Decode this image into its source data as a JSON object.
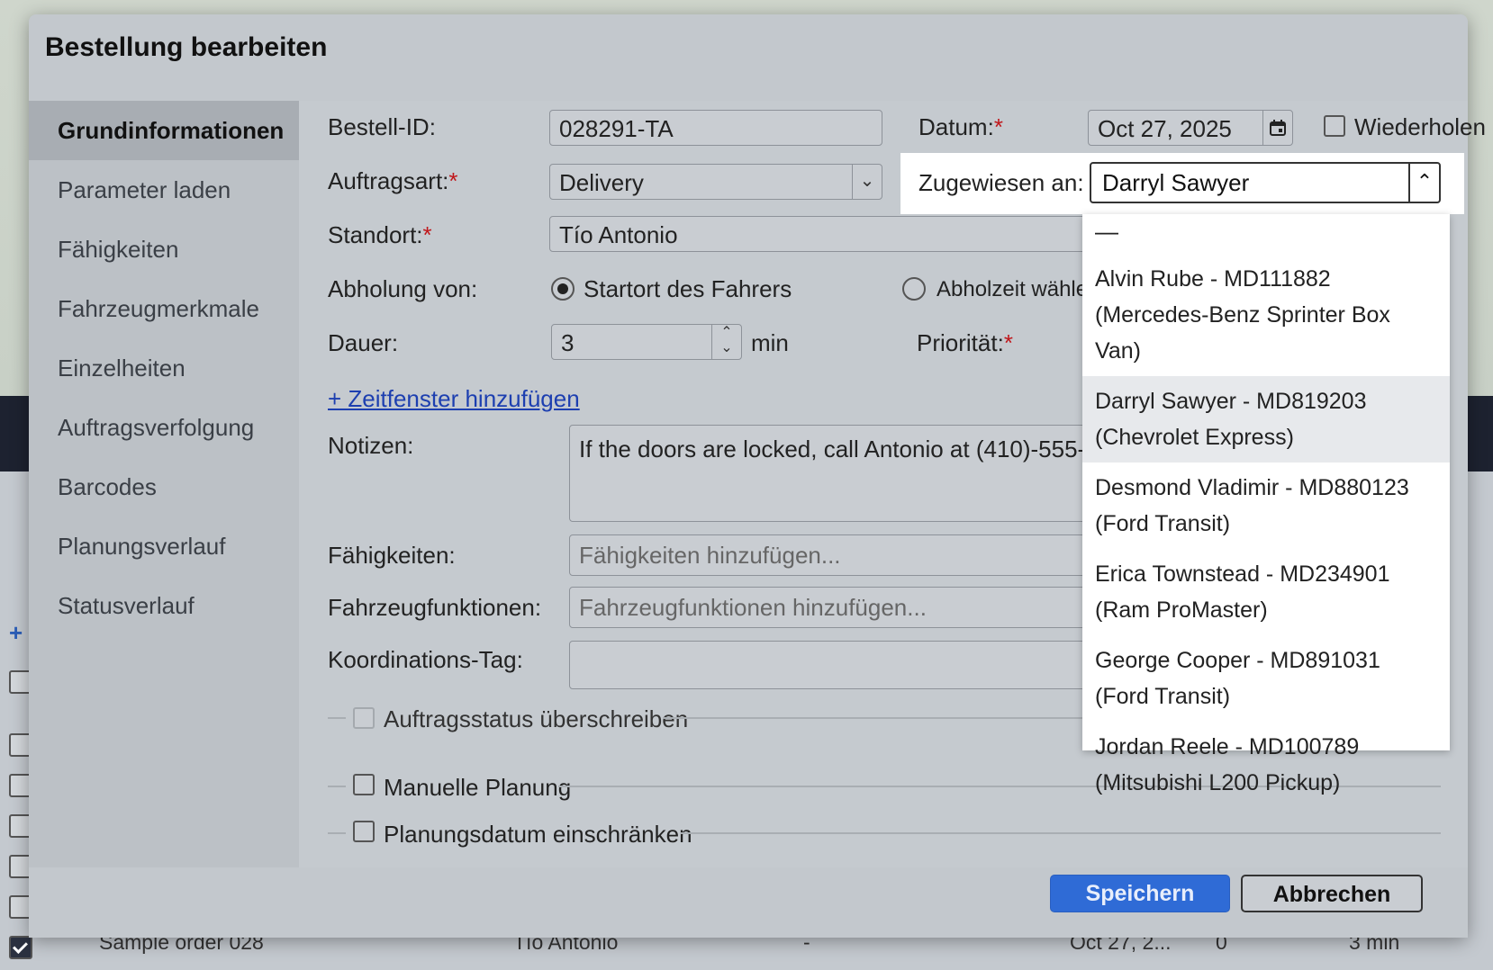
{
  "modal": {
    "title": "Bestellung bearbeiten"
  },
  "sidebar": {
    "items": [
      {
        "label": "Grundinformationen",
        "active": true
      },
      {
        "label": "Parameter laden"
      },
      {
        "label": "Fähigkeiten"
      },
      {
        "label": "Fahrzeugmerkmale"
      },
      {
        "label": "Einzelheiten"
      },
      {
        "label": "Auftragsverfolgung"
      },
      {
        "label": "Barcodes"
      },
      {
        "label": "Planungsverlauf"
      },
      {
        "label": "Statusverlauf"
      }
    ]
  },
  "form": {
    "order_id": {
      "label": "Bestell-ID:",
      "value": "028291-TA"
    },
    "date": {
      "label": "Datum:",
      "value": "Oct 27, 2025",
      "required": "*"
    },
    "repeat": {
      "label": "Wiederholen",
      "checked": false
    },
    "order_type": {
      "label": "Auftragsart:",
      "value": "Delivery",
      "required": "*"
    },
    "assigned_to": {
      "label": "Zugewiesen an:",
      "value": "Darryl Sawyer"
    },
    "location": {
      "label": "Standort:",
      "value": "Tío Antonio",
      "required": "*"
    },
    "pickup": {
      "label": "Abholung von:",
      "option_driver_start": "Startort des Fahrers",
      "option_choose_time": "Abholzeit wählen",
      "selected": "driver_start"
    },
    "duration": {
      "label": "Dauer:",
      "value": "3",
      "unit": "min"
    },
    "priority": {
      "label": "Priorität:",
      "required": "*"
    },
    "add_time_window": "+ Zeitfenster hinzufügen",
    "notes": {
      "label": "Notizen:",
      "value": "If the doors are locked, call Antonio at (410)-555-"
    },
    "skills": {
      "label": "Fähigkeiten:",
      "placeholder": "Fähigkeiten hinzufügen..."
    },
    "vehicle_features": {
      "label": "Fahrzeugfunktionen:",
      "placeholder": "Fahrzeugfunktionen hinzufügen..."
    },
    "coordination_tag": {
      "label": "Koordinations-Tag:",
      "value": ""
    },
    "override_status": {
      "label": "Auftragsstatus überschreiben",
      "checked": false,
      "disabled": true
    },
    "manual_planning": {
      "label": "Manuelle Planung",
      "checked": false
    },
    "restrict_planning_date": {
      "label": "Planungsdatum einschränken",
      "checked": false
    }
  },
  "dropdown": {
    "empty_option": "—",
    "options": [
      {
        "line1": "Alvin Rube - MD111882",
        "line2": "(Mercedes-Benz Sprinter Box Van)"
      },
      {
        "line1": "Darryl Sawyer - MD819203",
        "line2": "(Chevrolet Express)",
        "selected": true
      },
      {
        "line1": "Desmond Vladimir - MD880123",
        "line2": "(Ford Transit)"
      },
      {
        "line1": "Erica Townstead - MD234901",
        "line2": "(Ram ProMaster)"
      },
      {
        "line1": "George Cooper - MD891031",
        "line2": "(Ford Transit)"
      },
      {
        "line1": "Jordan Reele - MD100789",
        "line2": "(Mitsubishi L200 Pickup)"
      }
    ]
  },
  "buttons": {
    "save": "Speichern",
    "cancel": "Abbrechen"
  },
  "background_row": {
    "name": "Sample order 028",
    "location": "Tío Antonio",
    "dash": "-",
    "date": "Oct 27, 2...",
    "count": "0",
    "duration": "3 min"
  },
  "colors": {
    "primary": "#2f6bd6",
    "required": "#c0161a",
    "link": "#1d3fb0"
  }
}
